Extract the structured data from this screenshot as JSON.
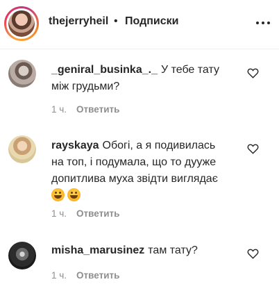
{
  "header": {
    "username": "thejerryheil",
    "separator": "•",
    "follow_label": "Подписки",
    "more_icon": "more-horizontal-icon"
  },
  "comments": [
    {
      "username": "_geniral_businka_._",
      "text": "У тебе тату між грудьми?",
      "time": "1 ч.",
      "reply_label": "Ответить"
    },
    {
      "username": "rayskaya",
      "text": "Обогі, а я подивилась на топ, і подумала, що то дууже допитлива муха звідти виглядає",
      "emojis": [
        "rolling-laughing-emoji",
        "grinning-sweat-emoji"
      ],
      "time": "1 ч.",
      "reply_label": "Ответить"
    },
    {
      "username": "misha_marusinez",
      "text": "там тату?",
      "time": "1 ч.",
      "reply_label": "Ответить"
    }
  ],
  "colors": {
    "text": "#262626",
    "secondary": "#8e8e8e",
    "divider": "#efefef"
  }
}
